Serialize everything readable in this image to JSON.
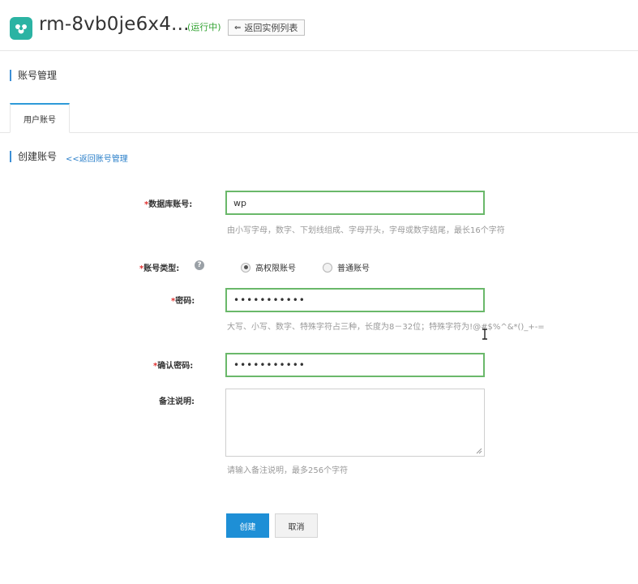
{
  "header": {
    "instance_name": "rm-8vb0je6x4...",
    "status": "(运行中)",
    "back_to_list": "返回实例列表",
    "back_icon": "back-arrow-icon"
  },
  "section": {
    "title": "账号管理"
  },
  "tabs": [
    {
      "label": "用户账号",
      "active": true
    }
  ],
  "create": {
    "title": "创建账号",
    "back_link": "<<返回账号管理"
  },
  "form": {
    "required_mark": "*",
    "db_account": {
      "label": "数据库账号:",
      "value": "wp",
      "hint": "由小写字母，数字、下划线组成、字母开头，字母或数字结尾，最长16个字符"
    },
    "account_type": {
      "label": "账号类型:",
      "help_icon": "?",
      "options": [
        {
          "label": "高权限账号",
          "selected": true
        },
        {
          "label": "普通账号",
          "selected": false
        }
      ]
    },
    "password": {
      "label": "密码:",
      "value": "•••••••••••",
      "hint": "大写、小写、数字、特殊字符占三种，长度为8－32位；特殊字符为!@#$%^&*()_+-="
    },
    "confirm_password": {
      "label": "确认密码:",
      "value": "•••••••••••"
    },
    "remark": {
      "label": "备注说明:",
      "value": "",
      "hint": "请输入备注说明，最多256个字符"
    }
  },
  "actions": {
    "create": "创建",
    "cancel": "取消"
  },
  "colors": {
    "accent": "#1e8fd6",
    "status_green": "#2fa12f",
    "logo": "#2bb3a3",
    "required": "#e0302f",
    "input_border": "#6ab86a"
  }
}
